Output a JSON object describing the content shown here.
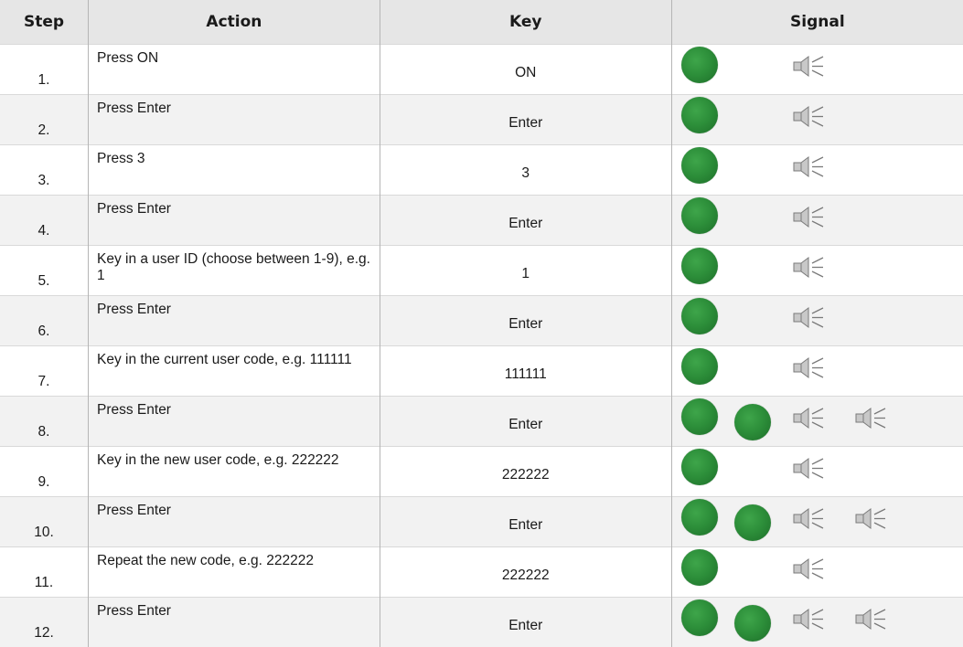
{
  "headers": {
    "step": "Step",
    "action": "Action",
    "key": "Key",
    "signal": "Signal"
  },
  "rows": [
    {
      "step": "1.",
      "action": "Press ON",
      "key": "ON",
      "leds": 1,
      "beeps": 1
    },
    {
      "step": "2.",
      "action": "Press Enter",
      "key": "Enter",
      "leds": 1,
      "beeps": 1
    },
    {
      "step": "3.",
      "action": "Press 3",
      "key": "3",
      "leds": 1,
      "beeps": 1
    },
    {
      "step": "4.",
      "action": "Press Enter",
      "key": "Enter",
      "leds": 1,
      "beeps": 1
    },
    {
      "step": "5.",
      "action": "Key in a user ID  (choose between 1-9), e.g. 1",
      "key": "1",
      "leds": 1,
      "beeps": 1
    },
    {
      "step": "6.",
      "action": "Press Enter",
      "key": "Enter",
      "leds": 1,
      "beeps": 1
    },
    {
      "step": "7.",
      "action": "Key in the current user code, e.g. 111111",
      "key": "111111",
      "leds": 1,
      "beeps": 1
    },
    {
      "step": "8.",
      "action": "Press Enter",
      "key": "Enter",
      "leds": 2,
      "beeps": 2
    },
    {
      "step": "9.",
      "action": "Key in the new user code, e.g. 222222",
      "key": "222222",
      "leds": 1,
      "beeps": 1
    },
    {
      "step": "10.",
      "action": "Press Enter",
      "key": "Enter",
      "leds": 2,
      "beeps": 2
    },
    {
      "step": "11.",
      "action": "Repeat the new code, e.g. 222222",
      "key": "222222",
      "leds": 1,
      "beeps": 1
    },
    {
      "step": "12.",
      "action": "Press Enter",
      "key": "Enter",
      "leds": 2,
      "beeps": 2
    }
  ],
  "colors": {
    "led": "#2d8f3a",
    "header_bg": "#e6e6e6",
    "stripe_bg": "#f2f2f2",
    "speaker": "#8a8a8a"
  },
  "icons": {
    "led": "green-led-icon",
    "signal": "speaker-icon"
  }
}
